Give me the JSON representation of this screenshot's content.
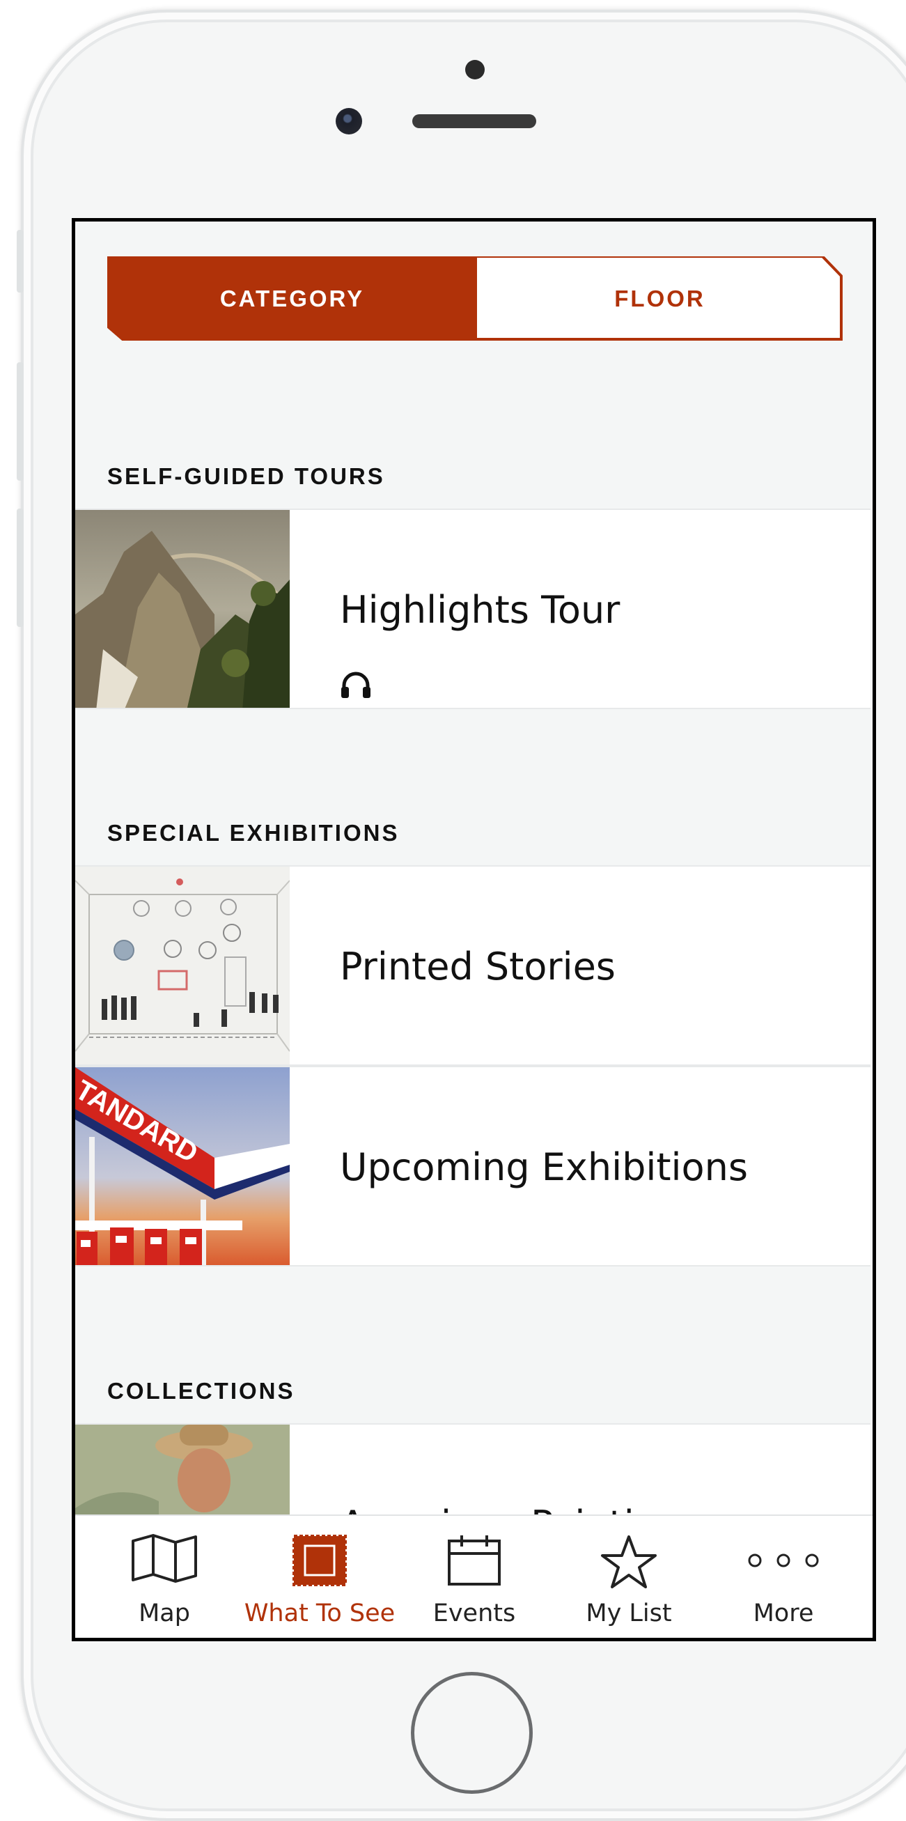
{
  "colors": {
    "accent": "#b03209",
    "background": "#f4f6f6",
    "row_background": "#ffffff"
  },
  "segmented_control": {
    "options": [
      "CATEGORY",
      "FLOOR"
    ],
    "selected": "CATEGORY"
  },
  "sections": [
    {
      "title": "SELF-GUIDED TOURS",
      "items": [
        {
          "title": "Highlights Tour",
          "icon": "headphones-icon"
        }
      ]
    },
    {
      "title": "SPECIAL EXHIBITIONS",
      "items": [
        {
          "title": "Printed Stories"
        },
        {
          "title": "Upcoming Exhibitions",
          "image_text": "TANDARD"
        }
      ]
    },
    {
      "title": "COLLECTIONS",
      "items": [
        {
          "title": "American Painting"
        }
      ]
    }
  ],
  "tab_bar": {
    "items": [
      {
        "label": "Map",
        "icon": "map-icon"
      },
      {
        "label": "What To See",
        "icon": "frame-icon",
        "active": true
      },
      {
        "label": "Events",
        "icon": "calendar-icon"
      },
      {
        "label": "My List",
        "icon": "star-icon"
      },
      {
        "label": "More",
        "icon": "more-dots-icon"
      }
    ]
  }
}
